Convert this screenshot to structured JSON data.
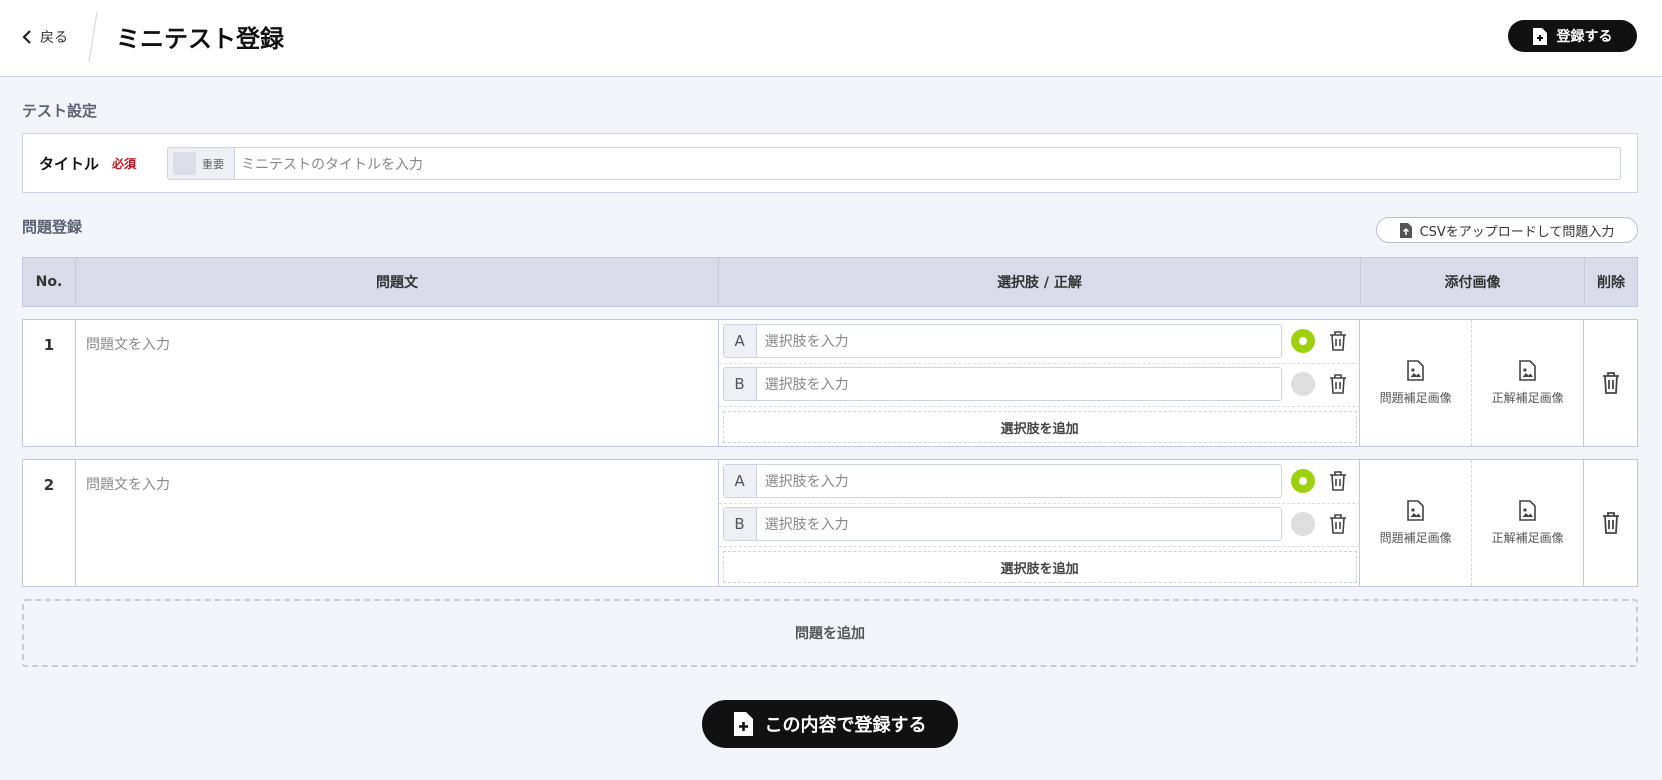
{
  "header": {
    "back_label": "戻る",
    "title": "ミニテスト登録",
    "register_label": "登録する"
  },
  "test_settings": {
    "section_title": "テスト設定",
    "title_label": "タイトル",
    "required_label": "必須",
    "important_label": "重要",
    "title_placeholder": "ミニテストのタイトルを入力"
  },
  "questions": {
    "section_title": "問題登録",
    "csv_button": "CSVをアップロードして問題入力",
    "headers": {
      "no": "No.",
      "question": "問題文",
      "choices": "選択肢 / 正解",
      "images": "添付画像",
      "delete": "削除"
    },
    "rows": [
      {
        "no": "1",
        "question_placeholder": "問題文を入力",
        "choices": [
          {
            "letter": "A",
            "placeholder": "選択肢を入力",
            "correct": true
          },
          {
            "letter": "B",
            "placeholder": "選択肢を入力",
            "correct": false
          }
        ],
        "add_choice": "選択肢を追加",
        "question_image": "問題補足画像",
        "answer_image": "正解補足画像"
      },
      {
        "no": "2",
        "question_placeholder": "問題文を入力",
        "choices": [
          {
            "letter": "A",
            "placeholder": "選択肢を入力",
            "correct": true
          },
          {
            "letter": "B",
            "placeholder": "選択肢を入力",
            "correct": false
          }
        ],
        "add_choice": "選択肢を追加",
        "question_image": "問題補足画像",
        "answer_image": "正解補足画像"
      }
    ],
    "add_question": "問題を追加"
  },
  "submit_label": "この内容で登録する",
  "colors": {
    "accent_dark": "#111111",
    "correct_green": "#9ed10b",
    "required_red": "#c0141f",
    "background": "#f2f4f9"
  }
}
